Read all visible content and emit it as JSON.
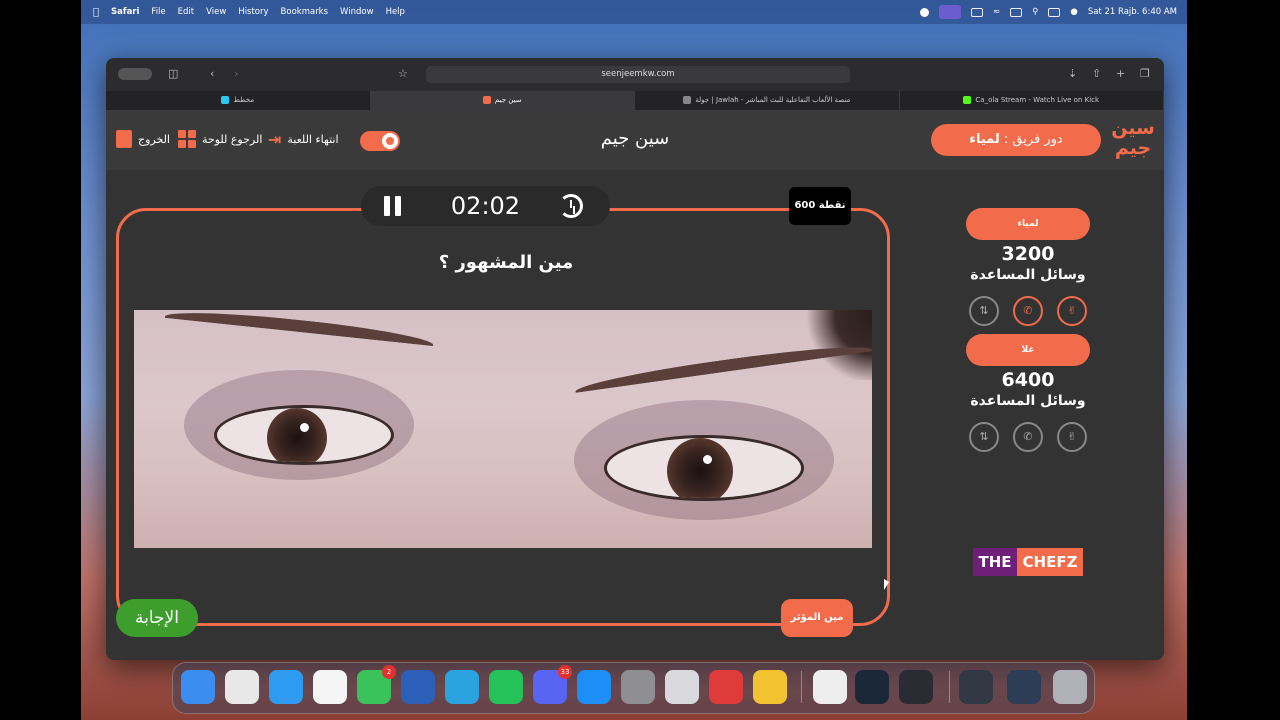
{
  "menubar": {
    "app": "Safari",
    "menus": [
      "File",
      "Edit",
      "View",
      "History",
      "Bookmarks",
      "Window",
      "Help"
    ],
    "clock": "Sat 21 Rajb.  6:40 AM"
  },
  "browser": {
    "url": "seenjeemkw.com",
    "tabs": [
      {
        "label": "مخطط",
        "color": "#2ac8f0"
      },
      {
        "label": "سين جيم",
        "color": "#f26b4a"
      },
      {
        "label": "جولة | Jawlah - منصة الألعاب التفاعلية للبث المباشر",
        "color": "#888888"
      },
      {
        "label": "Ca_ola Stream - Watch Live on Kick",
        "color": "#53fc18"
      }
    ]
  },
  "header": {
    "title": "سين جيم",
    "exit_label": "الخروج",
    "back_label": "الرجوع للوحة",
    "end_label": "انتهاء اللعبة",
    "turn_prefix": "دور فريق : ",
    "turn_team": "لمياء",
    "logo_text": "سين جيم"
  },
  "question": {
    "timer": "02:02",
    "points": "600 نقطة",
    "text": "مين المشهور ؟",
    "answer_label": "الإجابة",
    "influencer_label": "مين المؤثر"
  },
  "teams": [
    {
      "name": "لمياء",
      "score": "3200",
      "aids_label": "وسائل المساعدة",
      "aids_active": true
    },
    {
      "name": "علا",
      "score": "6400",
      "aids_label": "وسائل المساعدة",
      "aids_active": false
    }
  ],
  "sponsor": {
    "part1": "THE",
    "part2": "CHEFZ"
  },
  "dock": [
    {
      "name": "finder",
      "color": "#3b8ef0"
    },
    {
      "name": "launchpad",
      "color": "#e8e8e8"
    },
    {
      "name": "safari",
      "color": "#2f9bf0"
    },
    {
      "name": "photos",
      "color": "#f5f5f5"
    },
    {
      "name": "facetime",
      "color": "#3ac35a",
      "badge": "2"
    },
    {
      "name": "word",
      "color": "#2b5fb8"
    },
    {
      "name": "telegram",
      "color": "#2aa3e0"
    },
    {
      "name": "whatsapp",
      "color": "#25c159"
    },
    {
      "name": "discord",
      "color": "#5865f2",
      "badge": "33"
    },
    {
      "name": "app-store",
      "color": "#1c8ef5"
    },
    {
      "name": "system-settings",
      "color": "#8e8e93"
    },
    {
      "name": "iphone-mirroring",
      "color": "#d9d9de"
    },
    {
      "name": "parallels",
      "color": "#e03b3b"
    },
    {
      "name": "chrome",
      "color": "#f2c230"
    },
    {
      "name": "vpn",
      "color": "#eeeeee"
    },
    {
      "name": "steam",
      "color": "#1b2838"
    },
    {
      "name": "obs",
      "color": "#2b2b33"
    },
    {
      "name": "recent-window-1",
      "color": "#333845"
    },
    {
      "name": "recent-window-2",
      "color": "#2c3d55"
    },
    {
      "name": "trash",
      "color": "#b0b0b8"
    }
  ]
}
